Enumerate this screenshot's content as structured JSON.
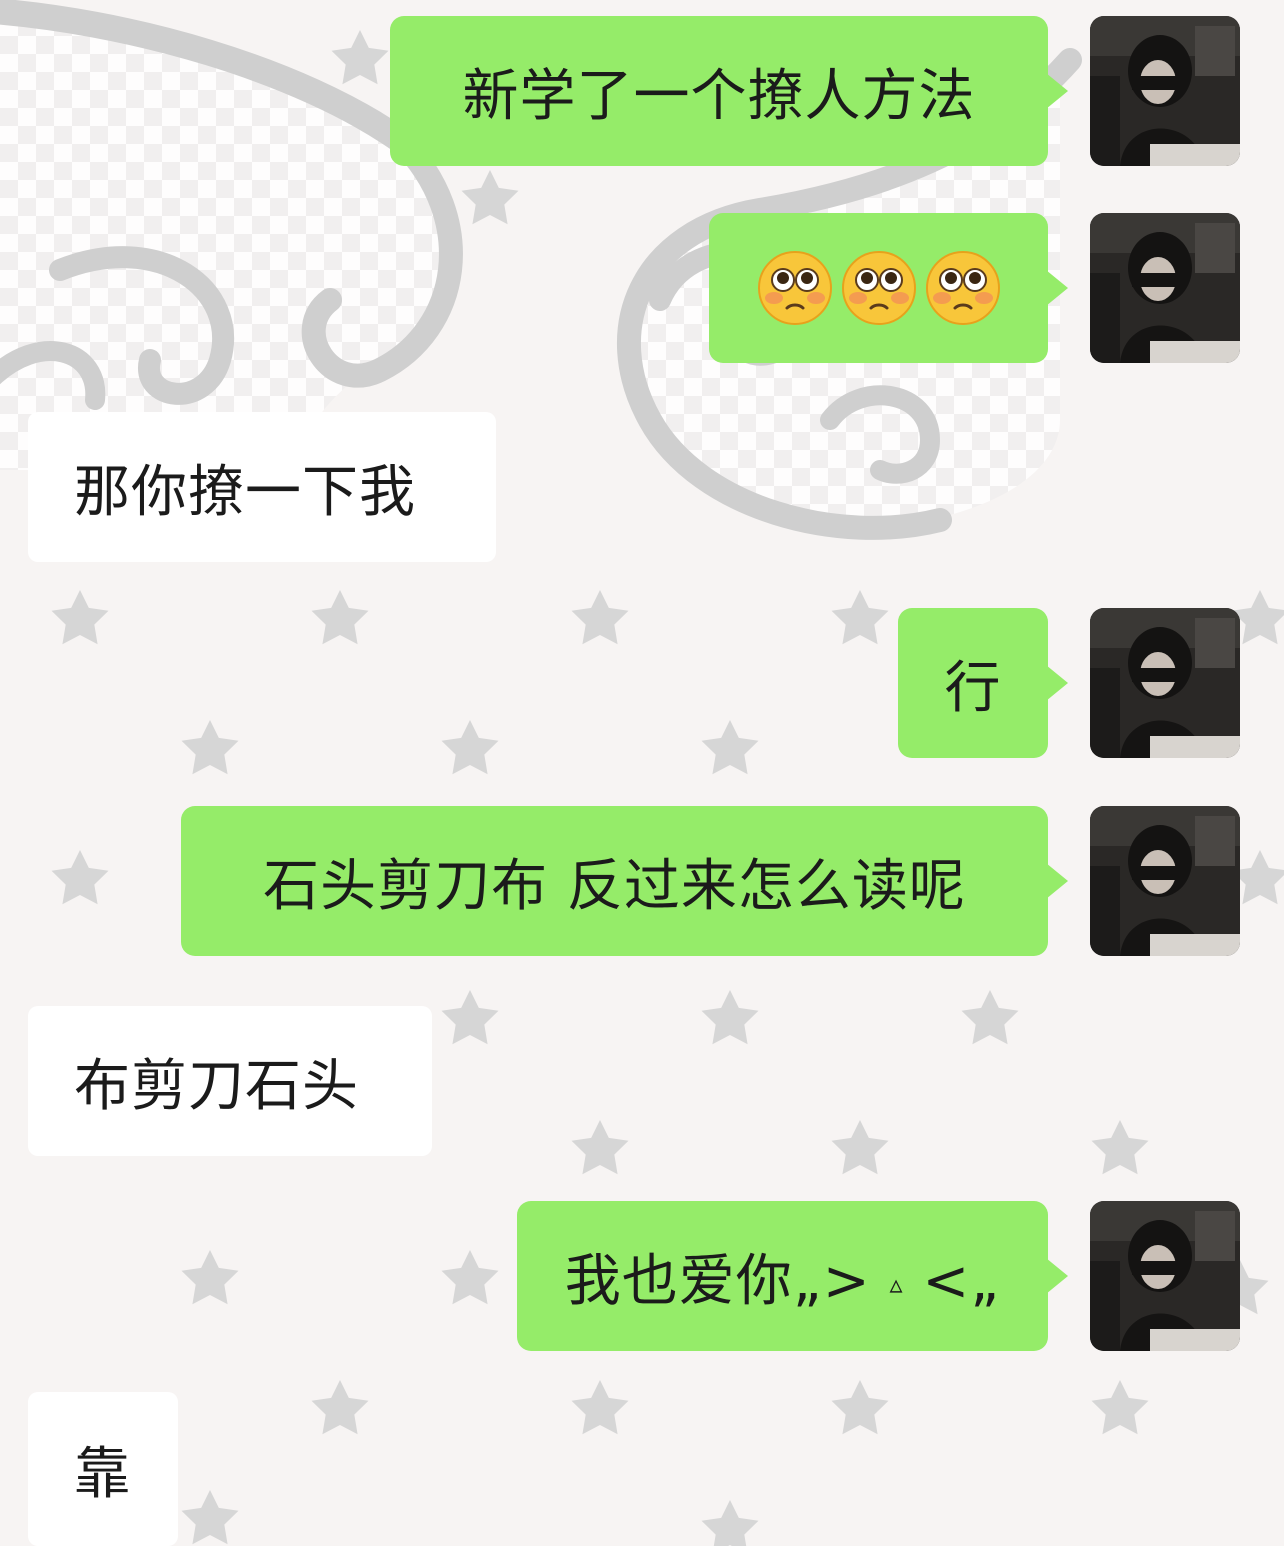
{
  "colors": {
    "outgoing_bubble": "#95ec69",
    "incoming_bubble": "#ffffff",
    "background": "#f7f4f3",
    "text": "#1b1b1b"
  },
  "background": {
    "decoration": "wing-and-star-pattern"
  },
  "messages": [
    {
      "id": "m1",
      "side": "out",
      "text": "新学了一个撩人方法",
      "avatar": "user-avatar"
    },
    {
      "id": "m2",
      "side": "out",
      "emoji": [
        "flushed-face",
        "flushed-face",
        "flushed-face"
      ],
      "avatar": "user-avatar"
    },
    {
      "id": "m3",
      "side": "in",
      "text": "那你撩一下我"
    },
    {
      "id": "m4",
      "side": "out",
      "text": "行",
      "avatar": "user-avatar"
    },
    {
      "id": "m5",
      "side": "out",
      "text": "石头剪刀布 反过来怎么读呢",
      "avatar": "user-avatar"
    },
    {
      "id": "m6",
      "side": "in",
      "text": "布剪刀石头"
    },
    {
      "id": "m7",
      "side": "out",
      "text_parts": [
        "我也爱你„> ",
        "▵",
        " <„"
      ],
      "avatar": "user-avatar"
    },
    {
      "id": "m8",
      "side": "in",
      "text": "靠"
    }
  ]
}
